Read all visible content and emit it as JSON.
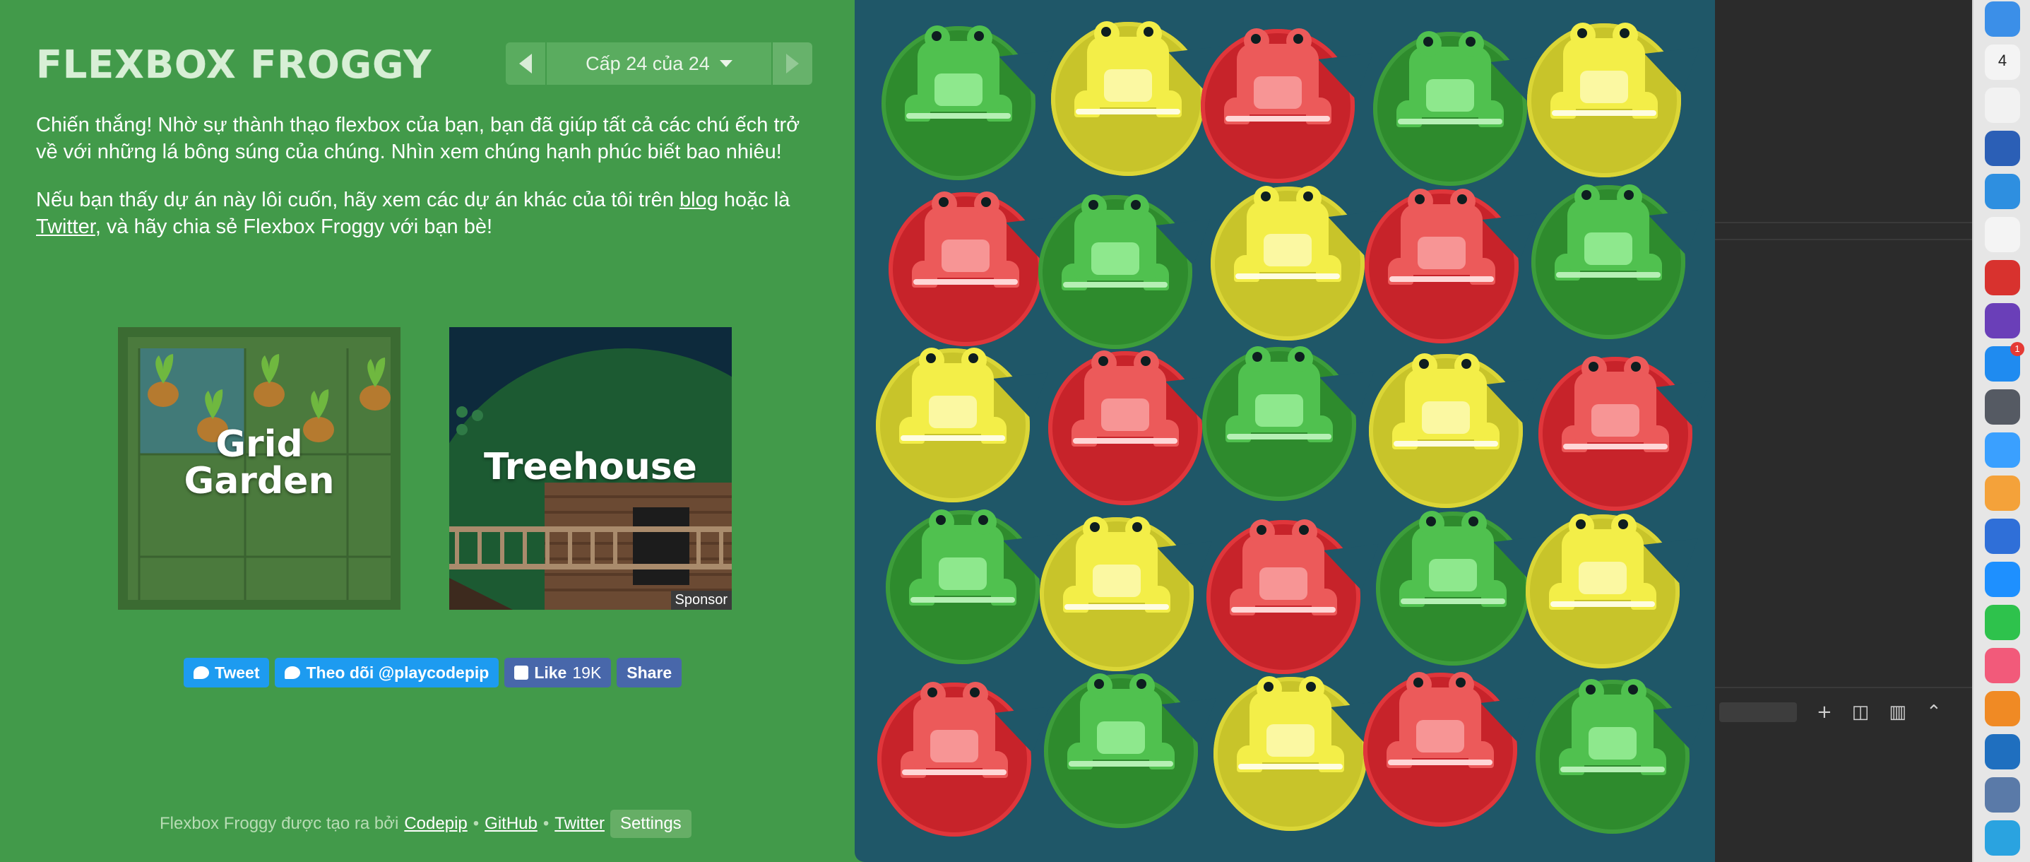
{
  "app": {
    "title": "FLEXBOX FROGGY",
    "level_indicator": "Cấp 24 của 24"
  },
  "messages": {
    "win": "Chiến thắng! Nhờ sự thành thạo flexbox của bạn, bạn đã giúp tất cả các chú ếch trở về với những lá bông súng của chúng. Nhìn xem chúng hạnh phúc biết bao nhiêu!",
    "more_a": "Nếu bạn thấy dự án này lôi cuốn, hãy xem các dự án khác của tôi trên ",
    "more_blog": "blog",
    "more_b": " hoặc là ",
    "more_twitter": "Twitter",
    "more_c": ", và hãy chia sẻ Flexbox Froggy với bạn bè!"
  },
  "promos": {
    "grid_garden_line1": "Grid",
    "grid_garden_line2": "Garden",
    "treehouse": "Treehouse",
    "sponsor": "Sponsor"
  },
  "social": {
    "tweet": "Tweet",
    "follow": "Theo dõi @playcodepip",
    "like": "Like",
    "like_count": "19K",
    "share": "Share"
  },
  "footer": {
    "credit": "Flexbox Froggy được tạo ra bởi",
    "codepip": "Codepip",
    "sep1": "•",
    "github": "GitHub",
    "sep2": "•",
    "twitter": "Twitter",
    "settings": "Settings"
  },
  "pond": {
    "colors": {
      "green": "#2e8b2d",
      "yellow": "#c8c42a",
      "red": "#c7232a",
      "water": "#1f5768"
    },
    "rows": [
      [
        "green",
        "yellow",
        "red",
        "green",
        "yellow"
      ],
      [
        "red",
        "green",
        "yellow",
        "red",
        "green"
      ],
      [
        "yellow",
        "red",
        "green",
        "yellow",
        "red"
      ],
      [
        "green",
        "yellow",
        "red",
        "green",
        "yellow"
      ],
      [
        "red",
        "green",
        "yellow",
        "red",
        "green"
      ]
    ]
  },
  "dock": {
    "calendar_day": "4",
    "appstore_badge": "1",
    "icons": [
      "finder-icon",
      "calendar-icon",
      "photos-icon",
      "word-icon",
      "safari-icon",
      "chrome-icon",
      "pdf-icon",
      "imovie-icon",
      "app-store-icon",
      "dvd-player-icon",
      "messages-icon",
      "pages-icon",
      "keynote-icon",
      "shield-app-icon",
      "facetime-icon",
      "music-icon",
      "books-icon",
      "vscode-icon",
      "preview-icon",
      "telegram-icon"
    ]
  }
}
